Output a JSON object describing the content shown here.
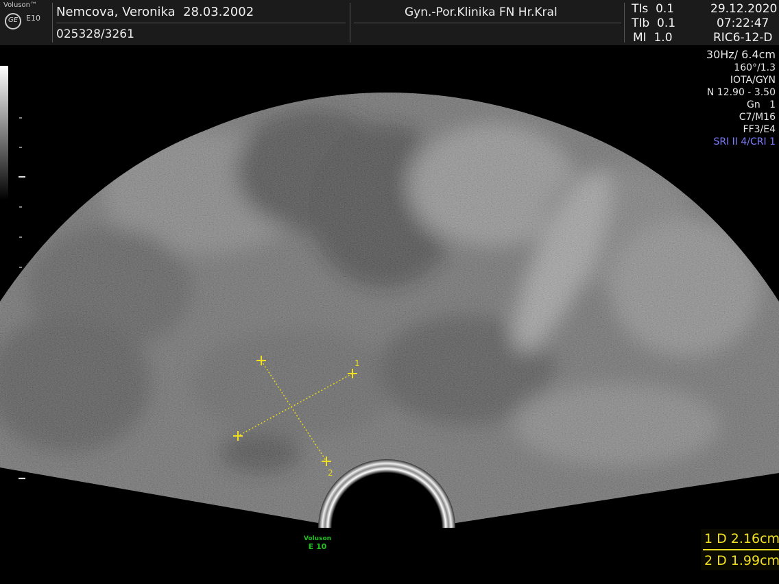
{
  "brand": {
    "name": "Voluson™",
    "model": "E10",
    "logo": "GE"
  },
  "header": {
    "patient_name": "Nemcova, Veronika  28.03.2002",
    "patient_id": "025328/3261",
    "clinic": "Gyn.-Por.Klinika FN Hr.Kral",
    "tis": "TIs  0.1",
    "tib": "TIb  0.1",
    "mi": "MI  1.0",
    "date": "29.12.2020",
    "time": "07:22:47",
    "probe": "RIC6-12-D"
  },
  "params": {
    "frame_depth": "30Hz/ 6.4cm",
    "angle": "160°/1.3",
    "preset": "IOTA/GYN",
    "freq": "N 12.90 - 3.50",
    "gain": "Gn   1",
    "map": "C7/M16",
    "ff": "FF3/E4",
    "sri": "SRI II 4/CRI 1"
  },
  "watermark": {
    "line1": "Voluson",
    "line2": "E 10"
  },
  "calipers": [
    {
      "id": "1"
    },
    {
      "id": "2"
    }
  ],
  "measurements": [
    {
      "label": "1 D 2.16cm",
      "distance_cm": 2.16
    },
    {
      "label": "2 D 1.99cm",
      "distance_cm": 1.99
    }
  ],
  "colors": {
    "caliper": "#f0e020",
    "sri": "#7f7fff",
    "watermark": "#22c022"
  }
}
